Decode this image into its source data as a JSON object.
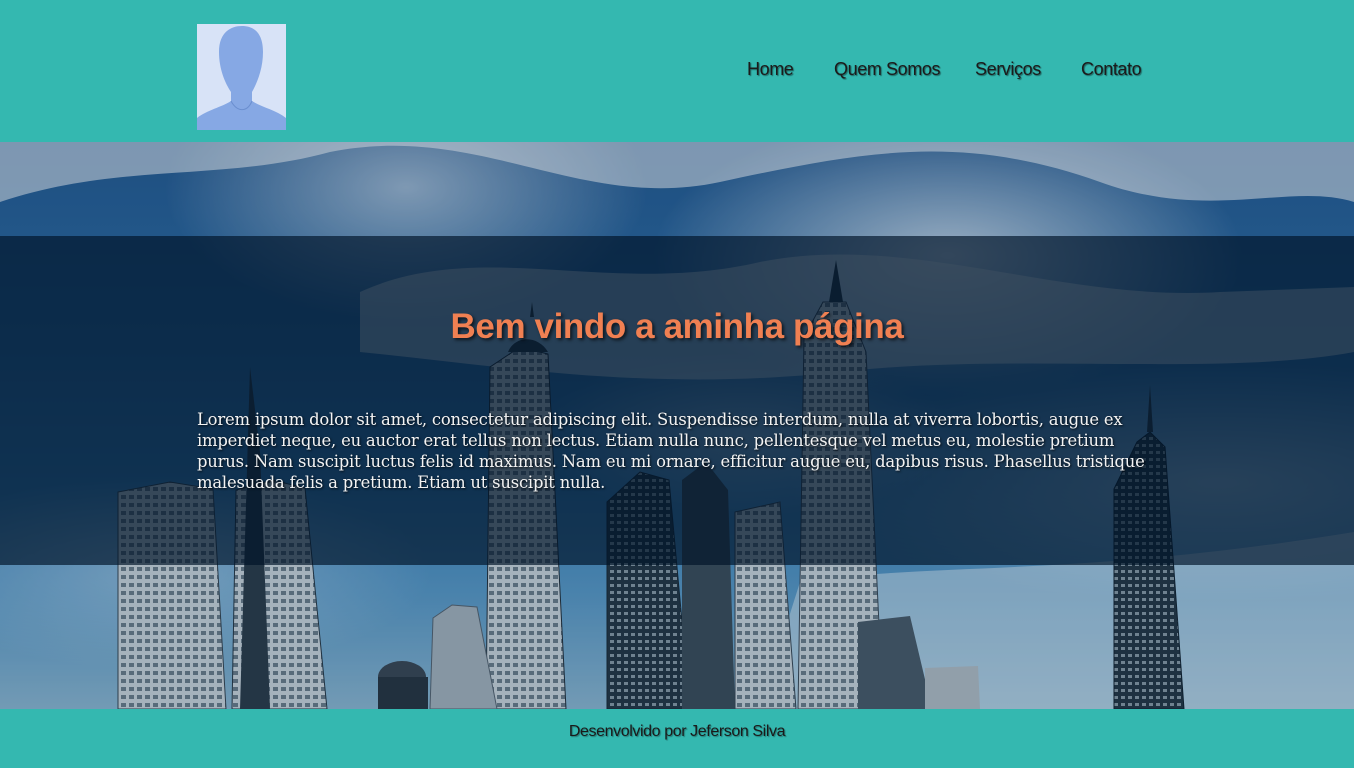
{
  "header": {
    "nav": [
      {
        "label": "Home"
      },
      {
        "label": "Quem Somos"
      },
      {
        "label": "Serviços"
      },
      {
        "label": "Contato"
      }
    ]
  },
  "hero": {
    "title": "Bem vindo a aminha página",
    "paragraph": "Lorem ipsum dolor sit amet, consectetur adipiscing elit. Suspendisse interdum, nulla at viverra lobortis, augue ex imperdiet neque, eu auctor erat tellus non lectus. Etiam nulla nunc, pellentesque vel metus eu, molestie pretium purus. Nam suscipit luctus felis id maximus. Nam eu mi ornare, efficitur augue eu, dapibus risus. Phasellus tristique malesuada felis a pretium. Etiam ut suscipit nulla."
  },
  "footer": {
    "text": "Desenvolvido por Jeferson Silva"
  },
  "colors": {
    "header_bg": "#34b8b0",
    "title": "#f08052",
    "text": "#f3f3f3"
  },
  "icons": {
    "avatar": "default-user-avatar"
  }
}
